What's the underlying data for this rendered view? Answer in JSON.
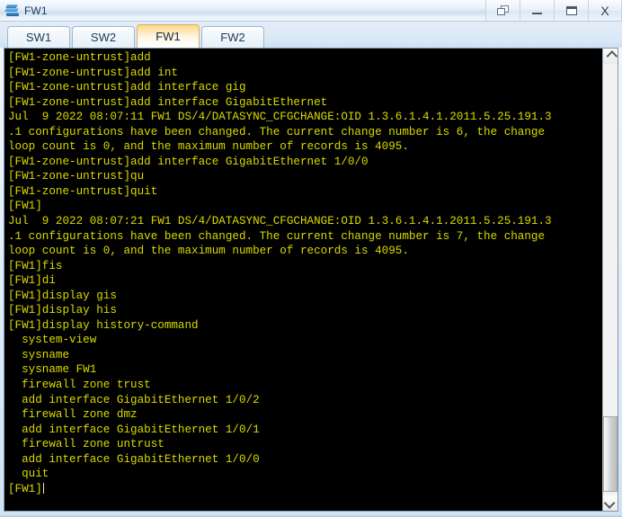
{
  "window": {
    "title": "FW1",
    "app_icon": "firewall-device-icon",
    "controls": [
      {
        "name": "restore-button",
        "icon": "restore-window-icon",
        "label": ""
      },
      {
        "name": "minimize-button",
        "icon": "minimize-icon",
        "label": ""
      },
      {
        "name": "maximize-button",
        "icon": "maximize-icon",
        "label": ""
      },
      {
        "name": "close-button",
        "icon": "close-icon",
        "label": "X"
      }
    ]
  },
  "tabs": [
    {
      "label": "SW1",
      "active": false
    },
    {
      "label": "SW2",
      "active": false
    },
    {
      "label": "FW1",
      "active": true
    },
    {
      "label": "FW2",
      "active": false
    }
  ],
  "colors": {
    "terminal_background": "#000000",
    "terminal_text": "#dada00",
    "active_tab_accent": "#fbd888",
    "title_bar": "#cfdfef"
  },
  "terminal": {
    "prompt_current": "[FW1]",
    "cursor_visible": true,
    "lines": [
      "[FW1-zone-untrust]add",
      "[FW1-zone-untrust]add int",
      "[FW1-zone-untrust]add interface gig",
      "[FW1-zone-untrust]add interface GigabitEthernet",
      "Jul  9 2022 08:07:11 FW1 DS/4/DATASYNC_CFGCHANGE:OID 1.3.6.1.4.1.2011.5.25.191.3",
      ".1 configurations have been changed. The current change number is 6, the change",
      "loop count is 0, and the maximum number of records is 4095.",
      "[FW1-zone-untrust]add interface GigabitEthernet 1/0/0",
      "[FW1-zone-untrust]qu",
      "[FW1-zone-untrust]quit",
      "[FW1]",
      "Jul  9 2022 08:07:21 FW1 DS/4/DATASYNC_CFGCHANGE:OID 1.3.6.1.4.1.2011.5.25.191.3",
      ".1 configurations have been changed. The current change number is 7, the change",
      "loop count is 0, and the maximum number of records is 4095.",
      "[FW1]fis",
      "[FW1]di",
      "[FW1]display gis",
      "[FW1]display his",
      "[FW1]display history-command",
      "  system-view",
      "  sysname",
      "  sysname FW1",
      "  firewall zone trust",
      "  add interface GigabitEthernet 1/0/2",
      "  firewall zone dmz",
      "  add interface GigabitEthernet 1/0/1",
      "  firewall zone untrust",
      "  add interface GigabitEthernet 1/0/0",
      "  quit"
    ]
  },
  "scrollbar": {
    "up_arrow": "chevron-up-icon",
    "down_arrow": "chevron-down-icon"
  }
}
